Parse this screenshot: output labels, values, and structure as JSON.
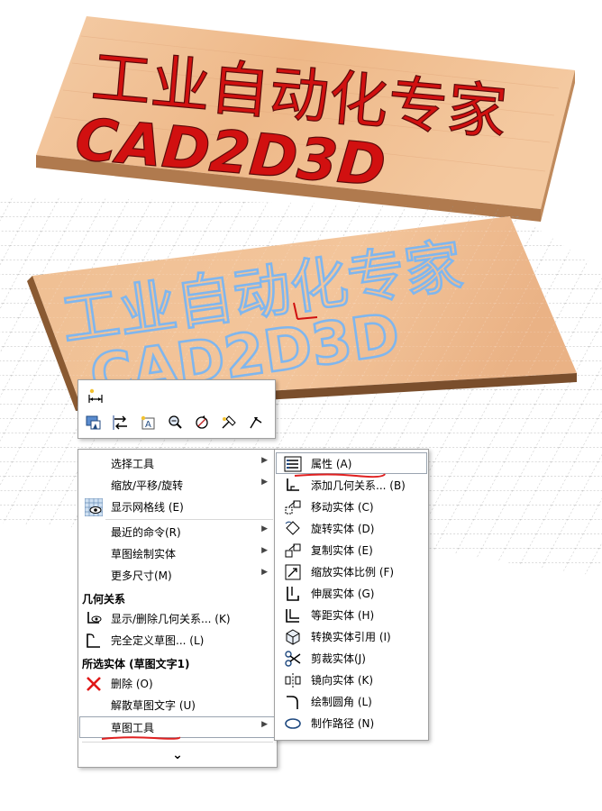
{
  "header_banner": {
    "line1": "工业自动化专家",
    "line2": "CAD2D3D"
  },
  "model_text": {
    "line1": "工业自动化专家",
    "line2": "CAD2D3D"
  },
  "mini_toolbar": {
    "icons": [
      "smart-dimension-icon",
      "sketch-picture-icon",
      "reverse-dimension-icon",
      "text-annotation-icon",
      "zoom-to-fit-icon",
      "rotate-view-icon",
      "trim-entity-icon",
      "extend-entity-icon"
    ]
  },
  "context_menu": {
    "items": [
      {
        "label": "选择工具"
      },
      {
        "label": "缩放/平移/旋转"
      },
      {
        "label": "显示网格线 (E)"
      },
      {
        "label": "最近的命令(R)"
      },
      {
        "label": "草图绘制实体"
      },
      {
        "label": "更多尺寸(M)"
      }
    ],
    "section_relations": "几何关系",
    "relations_items": [
      {
        "label": "显示/删除几何关系... (K)"
      },
      {
        "label": "完全定义草图... (L)"
      }
    ],
    "section_selected": "所选实体 (草图文字1)",
    "selected_items": [
      {
        "label": "删除 (O)"
      },
      {
        "label": "解散草图文字 (U)"
      },
      {
        "label": "草图工具"
      }
    ],
    "expand_glyph": "⌄"
  },
  "sub_menu": {
    "items": [
      {
        "label": "属性 (A)"
      },
      {
        "label": "添加几何关系... (B)"
      },
      {
        "label": "移动实体 (C)"
      },
      {
        "label": "旋转实体 (D)"
      },
      {
        "label": "复制实体 (E)"
      },
      {
        "label": "缩放实体比例 (F)"
      },
      {
        "label": "伸展实体 (G)"
      },
      {
        "label": "等距实体 (H)"
      },
      {
        "label": "转换实体引用 (I)"
      },
      {
        "label": "剪裁实体(J)"
      },
      {
        "label": "镜向实体 (K)"
      },
      {
        "label": "绘制圆角 (L)"
      },
      {
        "label": "制作路径 (N)"
      }
    ]
  },
  "colors": {
    "wood_light": "#f2c49a",
    "wood_dark": "#d99a66",
    "engrave_red": "#d11010",
    "sketch_blue": "#7fb6ee",
    "annotation_red": "#e02020",
    "grid": "#9a9a9a"
  }
}
